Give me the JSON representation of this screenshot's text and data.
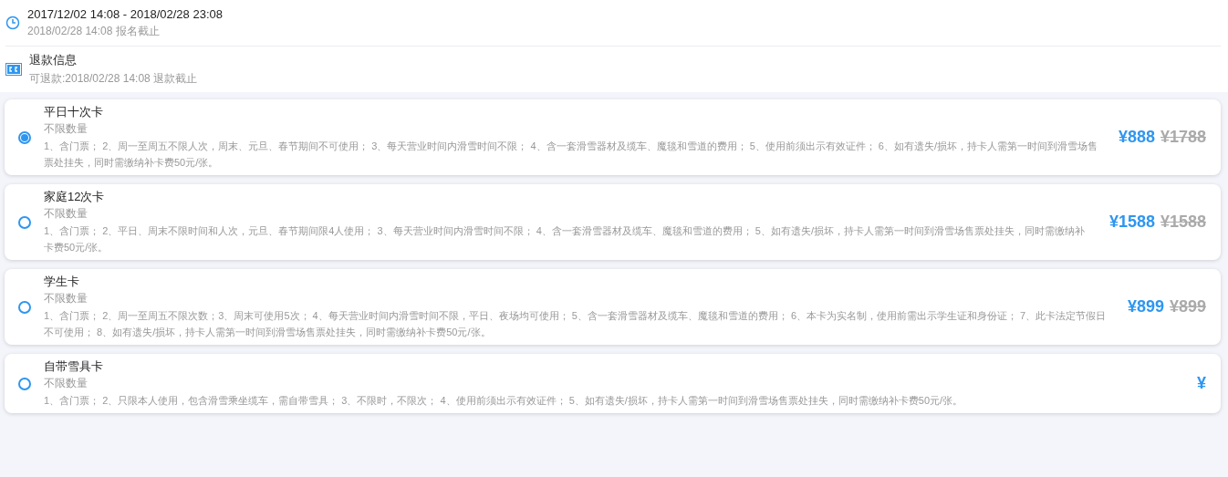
{
  "info_rows": [
    {
      "kind": "clock",
      "title": "2017/12/02 14:08 - 2018/02/28 23:08",
      "subtitle": "2018/02/28 14:08 报名截止"
    },
    {
      "kind": "cc",
      "title": "退款信息",
      "subtitle": "可退款:2018/02/28 14:08 退款截止"
    }
  ],
  "cards": [
    {
      "title": "平日十次卡",
      "quantity": "不限数量",
      "selected": true,
      "description": "1、含门票； 2、周一至周五不限人次，周末、元旦、春节期间不可使用； 3、每天营业时间内滑雪时间不限； 4、含一套滑雪器材及缆车、魔毯和雪道的费用； 5、使用前须出示有效证件； 6、如有遗失/损坏，持卡人需第一时间到滑雪场售票处挂失，同时需缴纳补卡费50元/张。",
      "price": "¥888",
      "original_price": "¥1788"
    },
    {
      "title": "家庭12次卡",
      "quantity": "不限数量",
      "selected": false,
      "description": "1、含门票； 2、平日、周末不限时间和人次，元旦、春节期间限4人使用； 3、每天营业时间内滑雪时间不限； 4、含一套滑雪器材及缆车、魔毯和雪道的费用； 5、如有遗失/损坏，持卡人需第一时间到滑雪场售票处挂失，同时需缴纳补卡费50元/张。",
      "price": "¥1588",
      "original_price": "¥1588"
    },
    {
      "title": "学生卡",
      "quantity": "不限数量",
      "selected": false,
      "description": "1、含门票； 2、周一至周五不限次数；3、周末可使用5次； 4、每天营业时间内滑雪时间不限，平日、夜场均可使用； 5、含一套滑雪器材及缆车、魔毯和雪道的费用； 6、本卡为实名制，使用前需出示学生证和身份证； 7、此卡法定节假日不可使用； 8、如有遗失/损坏，持卡人需第一时间到滑雪场售票处挂失，同时需缴纳补卡费50元/张。",
      "price": "¥899",
      "original_price": "¥899"
    },
    {
      "title": "自带雪具卡",
      "quantity": "不限数量",
      "selected": false,
      "description": "1、含门票； 2、只限本人使用，包含滑雪乘坐缆车，需自带雪具； 3、不限时，不限次； 4、使用前须出示有效证件； 5、如有遗失/损坏，持卡人需第一时间到滑雪场售票处挂失，同时需缴纳补卡费50元/张。",
      "price": "¥"
    }
  ]
}
